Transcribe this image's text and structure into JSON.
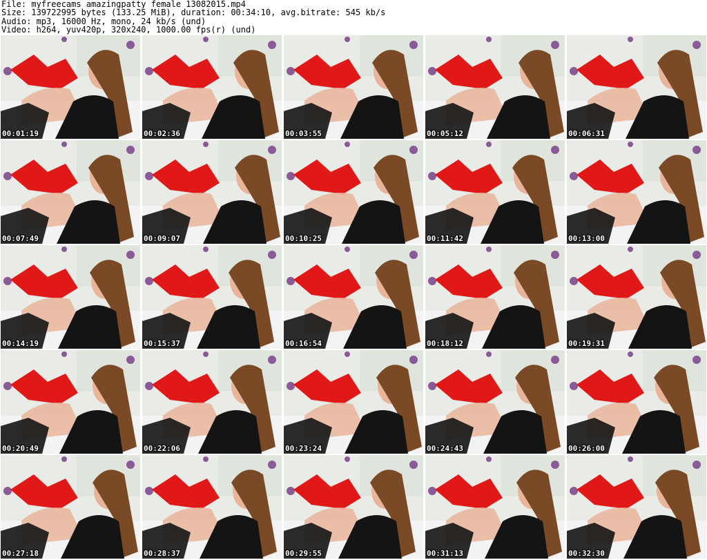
{
  "header": {
    "file_line": "File: myfreecams_amazingpatty_female_13082015.mp4",
    "size_line": "Size: 139722995 bytes (133.25 MiB), duration: 00:34:10, avg.bitrate: 545 kb/s",
    "audio_line": "Audio: mp3, 16000 Hz, mono, 24 kb/s (und)",
    "video_line": "Video: h264, yuv420p, 320x240, 1000.00 fps(r) (und)"
  },
  "colors": {
    "background": "#ffffff",
    "pillow_red": "#e01818",
    "wall": "#e9ece6",
    "sheet": "#f3f3f3",
    "dress": "#141414",
    "hair": "#7a4a26",
    "skin": "#e9b49a",
    "flower": "#8a5a96",
    "timestamp_text": "#ffffff"
  },
  "thumbnails": [
    {
      "timestamp": "00:01:19"
    },
    {
      "timestamp": "00:02:36"
    },
    {
      "timestamp": "00:03:55"
    },
    {
      "timestamp": "00:05:12"
    },
    {
      "timestamp": "00:06:31"
    },
    {
      "timestamp": "00:07:49"
    },
    {
      "timestamp": "00:09:07"
    },
    {
      "timestamp": "00:10:25"
    },
    {
      "timestamp": "00:11:42"
    },
    {
      "timestamp": "00:13:00"
    },
    {
      "timestamp": "00:14:19"
    },
    {
      "timestamp": "00:15:37"
    },
    {
      "timestamp": "00:16:54"
    },
    {
      "timestamp": "00:18:12"
    },
    {
      "timestamp": "00:19:31"
    },
    {
      "timestamp": "00:20:49"
    },
    {
      "timestamp": "00:22:06"
    },
    {
      "timestamp": "00:23:24"
    },
    {
      "timestamp": "00:24:43"
    },
    {
      "timestamp": "00:26:00"
    },
    {
      "timestamp": "00:27:18"
    },
    {
      "timestamp": "00:28:37"
    },
    {
      "timestamp": "00:29:55"
    },
    {
      "timestamp": "00:31:13"
    },
    {
      "timestamp": "00:32:30"
    }
  ]
}
